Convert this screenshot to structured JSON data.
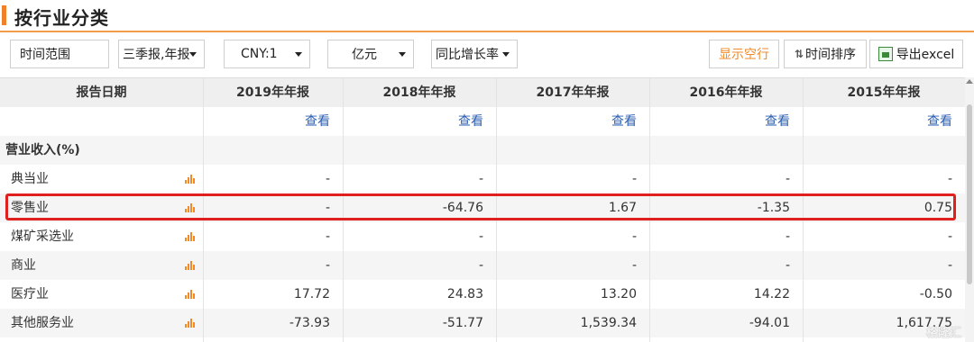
{
  "page": {
    "title": "按行业分类"
  },
  "toolbar": {
    "time_range": "时间范围",
    "report_type": "三季报,年报",
    "currency": "CNY:1",
    "unit": "亿元",
    "metric": "同比增长率",
    "show_empty": "显示空行",
    "time_sort": "时间排序",
    "export": "导出excel"
  },
  "table": {
    "columns": [
      "报告日期",
      "2019年年报",
      "2018年年报",
      "2017年年报",
      "2016年年报",
      "2015年年报"
    ],
    "view_label": "查看",
    "group_title": "营业收入(%)",
    "rows": [
      {
        "name": "典当业",
        "values": [
          "-",
          "-",
          "-",
          "-",
          "-"
        ]
      },
      {
        "name": "零售业",
        "values": [
          "-",
          "-64.76",
          "1.67",
          "-1.35",
          "0.75"
        ]
      },
      {
        "name": "煤矿采选业",
        "values": [
          "-",
          "-",
          "-",
          "-",
          "-"
        ]
      },
      {
        "name": "商业",
        "values": [
          "-",
          "-",
          "-",
          "-",
          "-"
        ]
      },
      {
        "name": "医疗业",
        "values": [
          "17.72",
          "24.83",
          "13.20",
          "14.22",
          "-0.50"
        ]
      },
      {
        "name": "其他服务业",
        "values": [
          "-73.93",
          "-51.77",
          "1,539.34",
          "-94.01",
          "1,617.75"
        ]
      }
    ],
    "highlighted_row": "零售业"
  },
  "watermark": "格隆汇",
  "colors": {
    "accent": "#f0812a",
    "link": "#2a5db0",
    "highlight": "#e0201f"
  }
}
